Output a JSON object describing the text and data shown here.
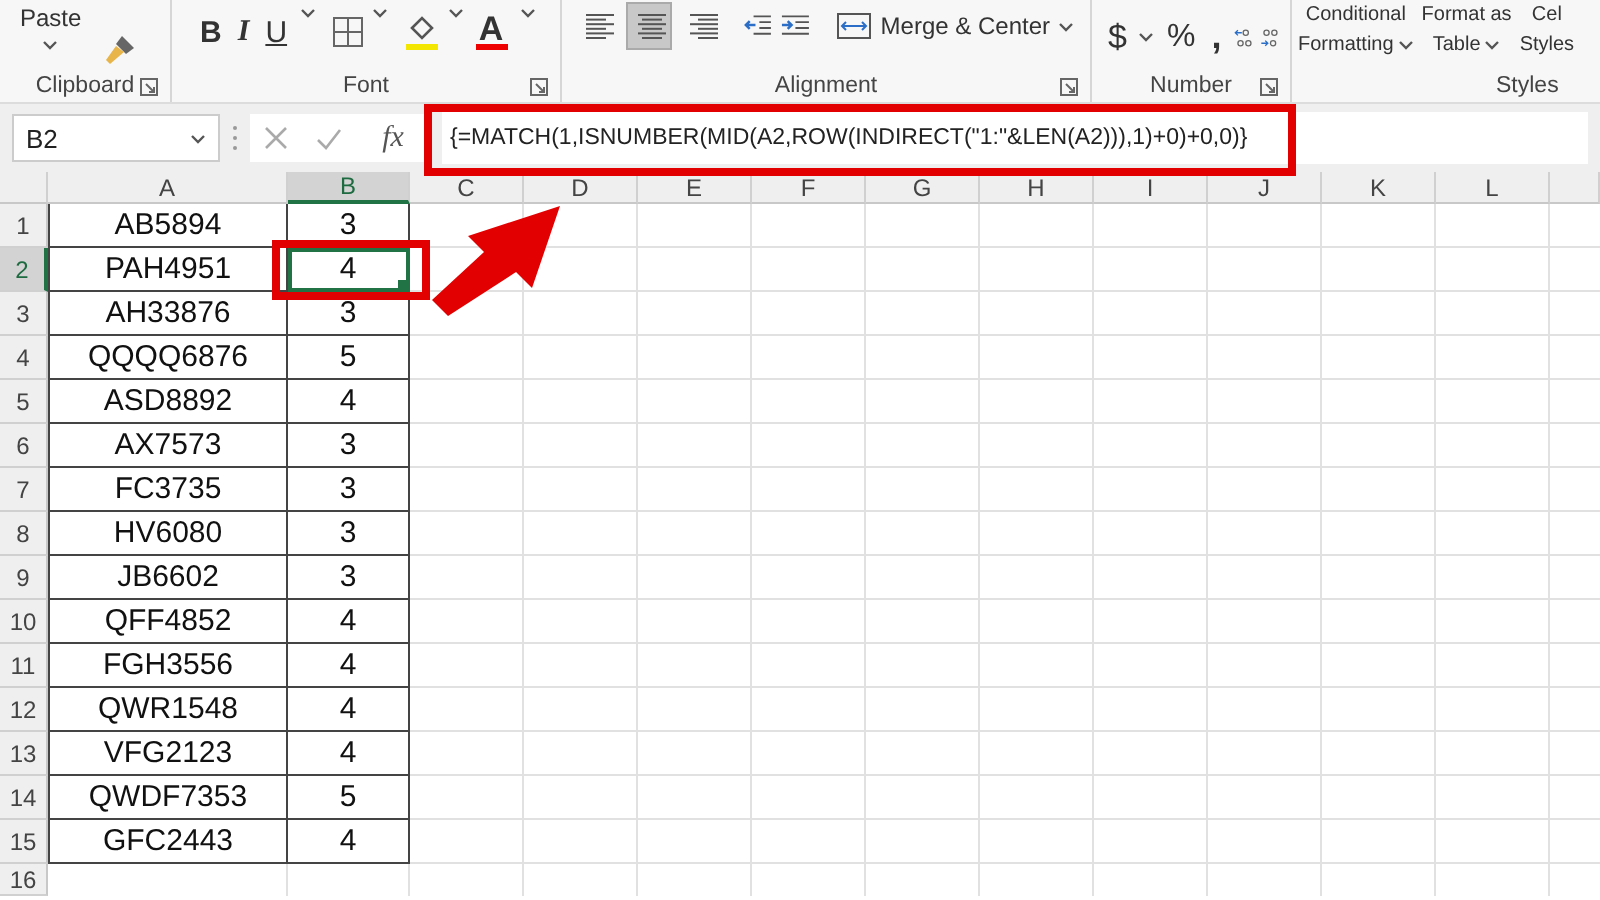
{
  "ribbon": {
    "clipboard": {
      "paste": "Paste",
      "label": "Clipboard"
    },
    "font": {
      "bold": "B",
      "italic": "I",
      "underline": "U",
      "font_color": "A",
      "label": "Font"
    },
    "alignment": {
      "align": [
        {
          "selected": false
        },
        {
          "selected": true
        },
        {
          "selected": false
        }
      ],
      "merge": "Merge & Center",
      "label": "Alignment"
    },
    "number": {
      "currency": "$",
      "percent": "%",
      "comma": ",",
      "label": "Number"
    },
    "styles": {
      "items": [
        [
          "Conditional",
          "Formatting"
        ],
        [
          "Format as",
          "Table"
        ],
        [
          "Cel",
          "Styles"
        ]
      ],
      "label": "Styles"
    }
  },
  "formula_bar": {
    "name_box": "B2",
    "fx": "fx",
    "formula": "{=MATCH(1,ISNUMBER(MID(A2,ROW(INDIRECT(\"1:\"&LEN(A2))),1)+0)+0,0)}"
  },
  "sheet": {
    "columns": [
      {
        "label": "A",
        "selected": false
      },
      {
        "label": "B",
        "selected": true
      },
      {
        "label": "C",
        "selected": false
      },
      {
        "label": "D",
        "selected": false
      },
      {
        "label": "E",
        "selected": false
      },
      {
        "label": "F",
        "selected": false
      },
      {
        "label": "G",
        "selected": false
      },
      {
        "label": "H",
        "selected": false
      },
      {
        "label": "I",
        "selected": false
      },
      {
        "label": "J",
        "selected": false
      },
      {
        "label": "K",
        "selected": false
      },
      {
        "label": "L",
        "selected": false
      }
    ],
    "rows": [
      {
        "header": "1",
        "selected": false,
        "cells": [
          "AB5894",
          "3"
        ]
      },
      {
        "header": "2",
        "selected": true,
        "cells": [
          "PAH4951",
          "4"
        ]
      },
      {
        "header": "3",
        "selected": false,
        "cells": [
          "AH33876",
          "3"
        ]
      },
      {
        "header": "4",
        "selected": false,
        "cells": [
          "QQQQ6876",
          "5"
        ]
      },
      {
        "header": "5",
        "selected": false,
        "cells": [
          "ASD8892",
          "4"
        ]
      },
      {
        "header": "6",
        "selected": false,
        "cells": [
          "AX7573",
          "3"
        ]
      },
      {
        "header": "7",
        "selected": false,
        "cells": [
          "FC3735",
          "3"
        ]
      },
      {
        "header": "8",
        "selected": false,
        "cells": [
          "HV6080",
          "3"
        ]
      },
      {
        "header": "9",
        "selected": false,
        "cells": [
          "JB6602",
          "3"
        ]
      },
      {
        "header": "10",
        "selected": false,
        "cells": [
          "QFF4852",
          "4"
        ]
      },
      {
        "header": "11",
        "selected": false,
        "cells": [
          "FGH3556",
          "4"
        ]
      },
      {
        "header": "12",
        "selected": false,
        "cells": [
          "QWR1548",
          "4"
        ]
      },
      {
        "header": "13",
        "selected": false,
        "cells": [
          "VFG2123",
          "4"
        ]
      },
      {
        "header": "14",
        "selected": false,
        "cells": [
          "QWDF7353",
          "5"
        ]
      },
      {
        "header": "15",
        "selected": false,
        "cells": [
          "GFC2443",
          "4"
        ]
      },
      {
        "header": "16",
        "selected": false
      }
    ]
  }
}
